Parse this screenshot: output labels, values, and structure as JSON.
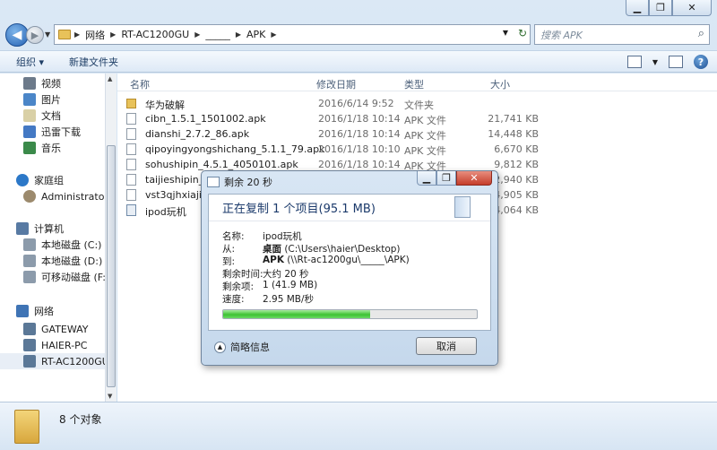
{
  "window": {
    "minimize": "▁",
    "maximize": "❐",
    "close": "✕"
  },
  "address": {
    "segments": [
      "网络",
      "RT-AC1200GU",
      "_____",
      "APK"
    ],
    "refresh": "↻"
  },
  "search": {
    "placeholder": "搜索 APK"
  },
  "toolbar": {
    "organize": "组织 ▾",
    "new_folder": "新建文件夹",
    "help": "?"
  },
  "nav": {
    "items": [
      {
        "label": "视频",
        "color": "#6c7a8a"
      },
      {
        "label": "图片",
        "color": "#4b86c8"
      },
      {
        "label": "文档",
        "color": "#d9d0a6"
      },
      {
        "label": "迅雷下载",
        "color": "#4479c4"
      },
      {
        "label": "音乐",
        "color": "#3b8a4a"
      },
      {
        "label": "家庭组",
        "color": "#2c78c8"
      },
      {
        "label": "Administrator (",
        "color": "#9c8a6d"
      },
      {
        "label": "计算机",
        "color": "#587aa3"
      },
      {
        "label": "本地磁盘 (C:)",
        "color": "#8c9bab"
      },
      {
        "label": "本地磁盘 (D:)",
        "color": "#8c9bab"
      },
      {
        "label": "可移动磁盘 (F:)",
        "color": "#8c9bab"
      },
      {
        "label": "网络",
        "color": "#3f74b5"
      },
      {
        "label": "GATEWAY",
        "color": "#5b7897"
      },
      {
        "label": "HAIER-PC",
        "color": "#5b7897"
      },
      {
        "label": "RT-AC1200GU",
        "color": "#5b7897"
      }
    ]
  },
  "columns": {
    "name": "名称",
    "modified": "修改日期",
    "type": "类型",
    "size": "大小"
  },
  "files": [
    {
      "name": "华为破解",
      "modified": "2016/6/14 9:52",
      "type": "文件夹",
      "size": "",
      "kind": "folder"
    },
    {
      "name": "cibn_1.5.1_1501002.apk",
      "modified": "2016/1/18 10:14",
      "type": "APK 文件",
      "size": "21,741 KB",
      "kind": "file"
    },
    {
      "name": "dianshi_2.7.2_86.apk",
      "modified": "2016/1/18 10:14",
      "type": "APK 文件",
      "size": "14,448 KB",
      "kind": "file"
    },
    {
      "name": "qipoyingyongshichang_5.1.1_79.apk",
      "modified": "2016/1/18 10:10",
      "type": "APK 文件",
      "size": "6,670 KB",
      "kind": "file"
    },
    {
      "name": "sohushipin_4.5.1_4050101.apk",
      "modified": "2016/1/18 10:14",
      "type": "APK 文件",
      "size": "9,812 KB",
      "kind": "file"
    },
    {
      "name": "taijieshipin_4",
      "modified": "",
      "type": "",
      "size": "12,940 KB",
      "kind": "file"
    },
    {
      "name": "vst3qjhxiajia_",
      "modified": "",
      "type": "",
      "size": "14,905 KB",
      "kind": "file"
    },
    {
      "name": "ipod玩机",
      "modified": "",
      "type": "",
      "size": "14,064 KB",
      "kind": "app"
    }
  ],
  "status": {
    "count": "8 个对象"
  },
  "dialog": {
    "title": "剩余 20 秒",
    "heading": "正在复制 1 个项目(95.1 MB)",
    "rows": [
      {
        "k": "名称:",
        "v": "ipod玩机",
        "bold": ""
      },
      {
        "k": "从:",
        "v": " (C:\\Users\\haier\\Desktop)",
        "bold": "桌面"
      },
      {
        "k": "到:",
        "v": " (\\\\Rt-ac1200gu\\_____\\APK)",
        "bold": "APK"
      },
      {
        "k": "剩余时间:",
        "v": "大约 20 秒",
        "bold": ""
      },
      {
        "k": "剩余项:",
        "v": "1 (41.9 MB)",
        "bold": ""
      },
      {
        "k": "速度:",
        "v": "2.95 MB/秒",
        "bold": ""
      }
    ],
    "progress": 0.58,
    "details": "简略信息",
    "cancel": "取消"
  }
}
